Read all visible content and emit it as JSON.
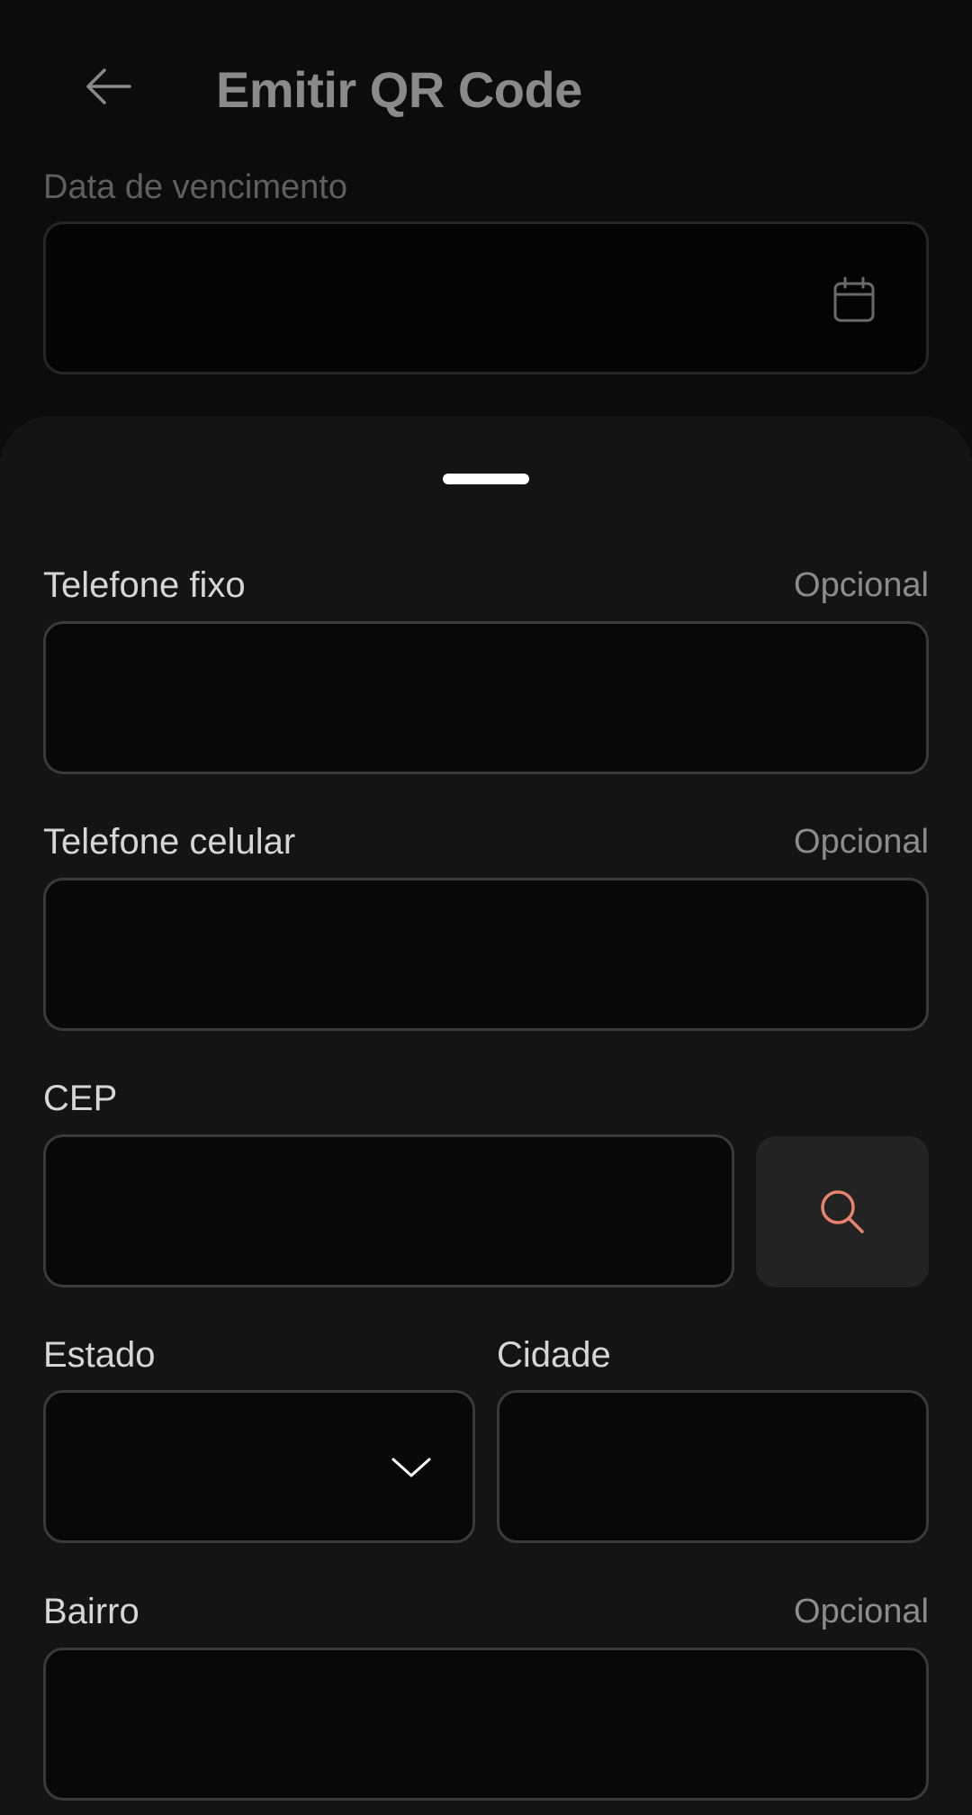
{
  "header": {
    "title": "Emitir QR Code",
    "back_icon": "arrow-left-icon"
  },
  "background_form": {
    "due_date_label": "Data de vencimento",
    "due_date_value": "",
    "calendar_icon": "calendar-icon"
  },
  "sheet": {
    "fields": {
      "landline": {
        "label": "Telefone fixo",
        "optional": "Opcional",
        "value": ""
      },
      "mobile": {
        "label": "Telefone celular",
        "optional": "Opcional",
        "value": ""
      },
      "cep": {
        "label": "CEP",
        "value": ""
      },
      "state": {
        "label": "Estado",
        "value": ""
      },
      "city": {
        "label": "Cidade",
        "value": ""
      },
      "neighborhood": {
        "label": "Bairro",
        "optional": "Opcional",
        "value": ""
      }
    },
    "search_icon": "search-icon",
    "dropdown_icon": "chevron-down-icon"
  },
  "colors": {
    "accent": "#E8846C",
    "sheet_bg": "#141414",
    "field_border": "#3A3A3A"
  }
}
